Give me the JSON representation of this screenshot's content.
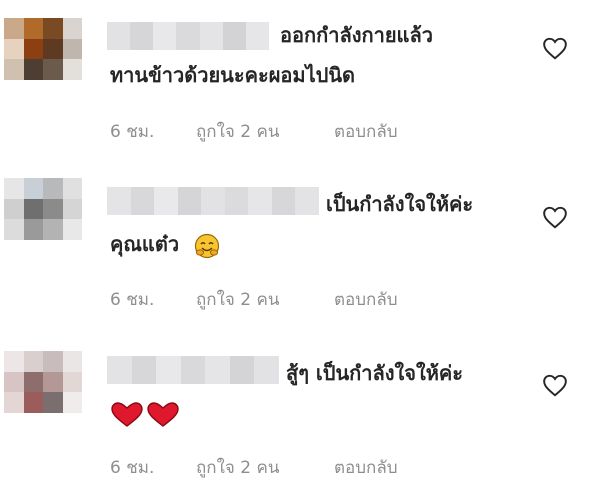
{
  "comments": [
    {
      "line1": "ออกกำลังกายแล้ว",
      "line2": "ทานข้าวด้วยนะคะผอมไปนิด",
      "time": "6 ชม.",
      "likes": "ถูกใจ 2 คน",
      "reply": "ตอบกลับ"
    },
    {
      "line1": "เป็นกำลังใจให้ค่ะ",
      "line2": "คุณแต๋ว",
      "line2_emoji": "smiling-hug-emoji",
      "time": "6 ชม.",
      "likes": "ถูกใจ 2 คน",
      "reply": "ตอบกลับ"
    },
    {
      "line1": "สู้ๆ เป็นกำลังใจให้ค่ะ",
      "line2_emoji": "red-hearts-emoji",
      "time": "6 ชม.",
      "likes": "ถูกใจ 2 คน",
      "reply": "ตอบกลับ"
    }
  ],
  "icons": {
    "like": "heart-outline-icon"
  },
  "colors": {
    "text": "#262626",
    "meta": "#8e8e8e",
    "heart_red": "#e0182d"
  }
}
